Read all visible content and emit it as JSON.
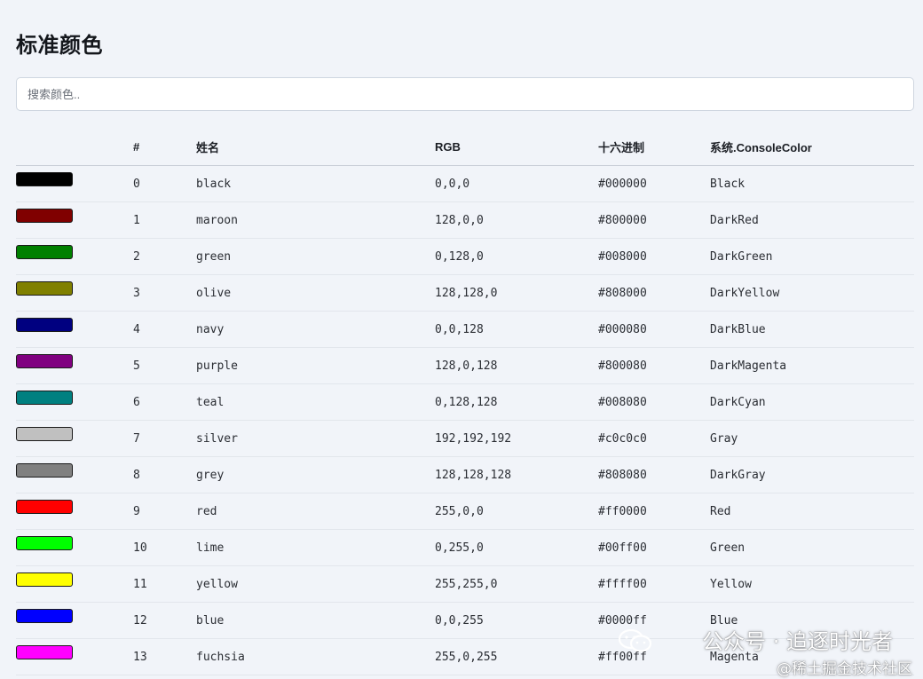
{
  "page": {
    "title": "标准颜色",
    "search_placeholder": "搜索颜色.."
  },
  "table": {
    "headers": [
      "",
      "#",
      "姓名",
      "RGB",
      "十六进制",
      "系统.ConsoleColor"
    ],
    "rows": [
      {
        "swatch": "#000000",
        "num": "0",
        "name": "black",
        "rgb": "0,0,0",
        "hex": "#000000",
        "console": "Black"
      },
      {
        "swatch": "#800000",
        "num": "1",
        "name": "maroon",
        "rgb": "128,0,0",
        "hex": "#800000",
        "console": "DarkRed"
      },
      {
        "swatch": "#008000",
        "num": "2",
        "name": "green",
        "rgb": "0,128,0",
        "hex": "#008000",
        "console": "DarkGreen"
      },
      {
        "swatch": "#808000",
        "num": "3",
        "name": "olive",
        "rgb": "128,128,0",
        "hex": "#808000",
        "console": "DarkYellow"
      },
      {
        "swatch": "#000080",
        "num": "4",
        "name": "navy",
        "rgb": "0,0,128",
        "hex": "#000080",
        "console": "DarkBlue"
      },
      {
        "swatch": "#800080",
        "num": "5",
        "name": "purple",
        "rgb": "128,0,128",
        "hex": "#800080",
        "console": "DarkMagenta"
      },
      {
        "swatch": "#008080",
        "num": "6",
        "name": "teal",
        "rgb": "0,128,128",
        "hex": "#008080",
        "console": "DarkCyan"
      },
      {
        "swatch": "#c0c0c0",
        "num": "7",
        "name": "silver",
        "rgb": "192,192,192",
        "hex": "#c0c0c0",
        "console": "Gray"
      },
      {
        "swatch": "#808080",
        "num": "8",
        "name": "grey",
        "rgb": "128,128,128",
        "hex": "#808080",
        "console": "DarkGray"
      },
      {
        "swatch": "#ff0000",
        "num": "9",
        "name": "red",
        "rgb": "255,0,0",
        "hex": "#ff0000",
        "console": "Red"
      },
      {
        "swatch": "#00ff00",
        "num": "10",
        "name": "lime",
        "rgb": "0,255,0",
        "hex": "#00ff00",
        "console": "Green"
      },
      {
        "swatch": "#ffff00",
        "num": "11",
        "name": "yellow",
        "rgb": "255,255,0",
        "hex": "#ffff00",
        "console": "Yellow"
      },
      {
        "swatch": "#0000ff",
        "num": "12",
        "name": "blue",
        "rgb": "0,0,255",
        "hex": "#0000ff",
        "console": "Blue"
      },
      {
        "swatch": "#ff00ff",
        "num": "13",
        "name": "fuchsia",
        "rgb": "255,0,255",
        "hex": "#ff00ff",
        "console": "Magenta"
      }
    ]
  },
  "watermark": {
    "icon": "wechat-icon",
    "line1": "公众号 · 追逐时光者",
    "line2": "@稀土掘金技术社区"
  },
  "colors": {
    "background": "#f1f4f9",
    "text": "#1a1d23"
  }
}
